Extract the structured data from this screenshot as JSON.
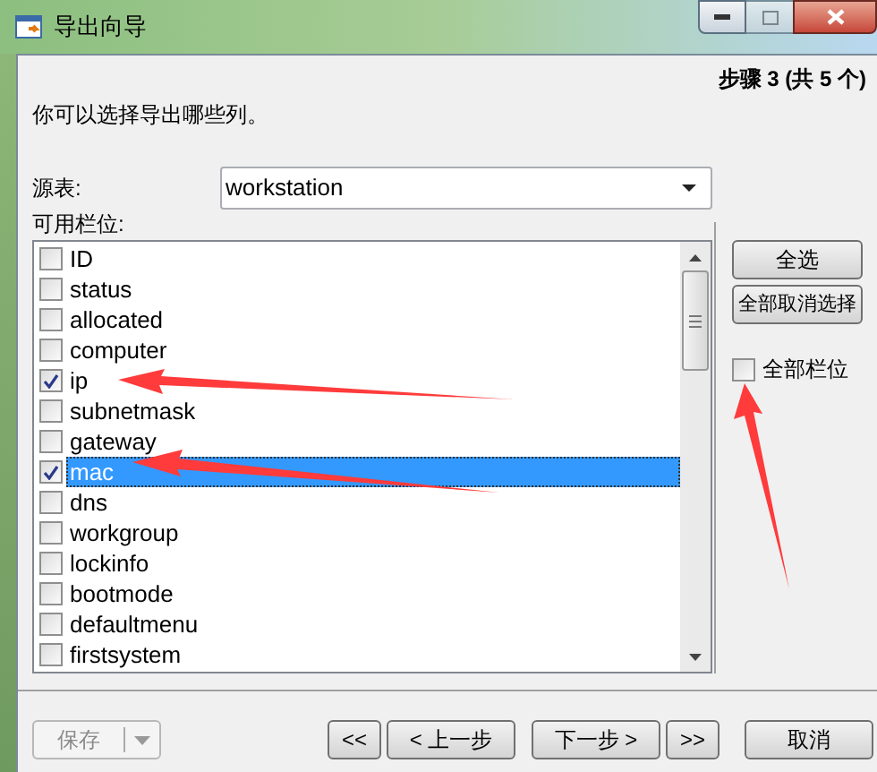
{
  "window": {
    "title": "导出向导"
  },
  "step": "步骤 3 (共 5 个)",
  "instruction": "你可以选择导出哪些列。",
  "source_table": {
    "label": "源表:",
    "value": "workstation"
  },
  "fields": {
    "label": "可用栏位:",
    "items": [
      {
        "label": "ID",
        "checked": false,
        "selected": false
      },
      {
        "label": "status",
        "checked": false,
        "selected": false
      },
      {
        "label": "allocated",
        "checked": false,
        "selected": false
      },
      {
        "label": "computer",
        "checked": false,
        "selected": false
      },
      {
        "label": "ip",
        "checked": true,
        "selected": false
      },
      {
        "label": "subnetmask",
        "checked": false,
        "selected": false
      },
      {
        "label": "gateway",
        "checked": false,
        "selected": false
      },
      {
        "label": "mac",
        "checked": true,
        "selected": true
      },
      {
        "label": "dns",
        "checked": false,
        "selected": false
      },
      {
        "label": "workgroup",
        "checked": false,
        "selected": false
      },
      {
        "label": "lockinfo",
        "checked": false,
        "selected": false
      },
      {
        "label": "bootmode",
        "checked": false,
        "selected": false
      },
      {
        "label": "defaultmenu",
        "checked": false,
        "selected": false
      },
      {
        "label": "firstsystem",
        "checked": false,
        "selected": false
      }
    ]
  },
  "select_all": "全选",
  "deselect_all": "全部取消选择",
  "all_fields": {
    "label": "全部栏位",
    "checked": false
  },
  "save": {
    "label": "保存",
    "disabled": true
  },
  "nav_buttons": [
    "<<",
    "< 上一步",
    "下一步 >",
    ">>"
  ],
  "cancel": "取消"
}
